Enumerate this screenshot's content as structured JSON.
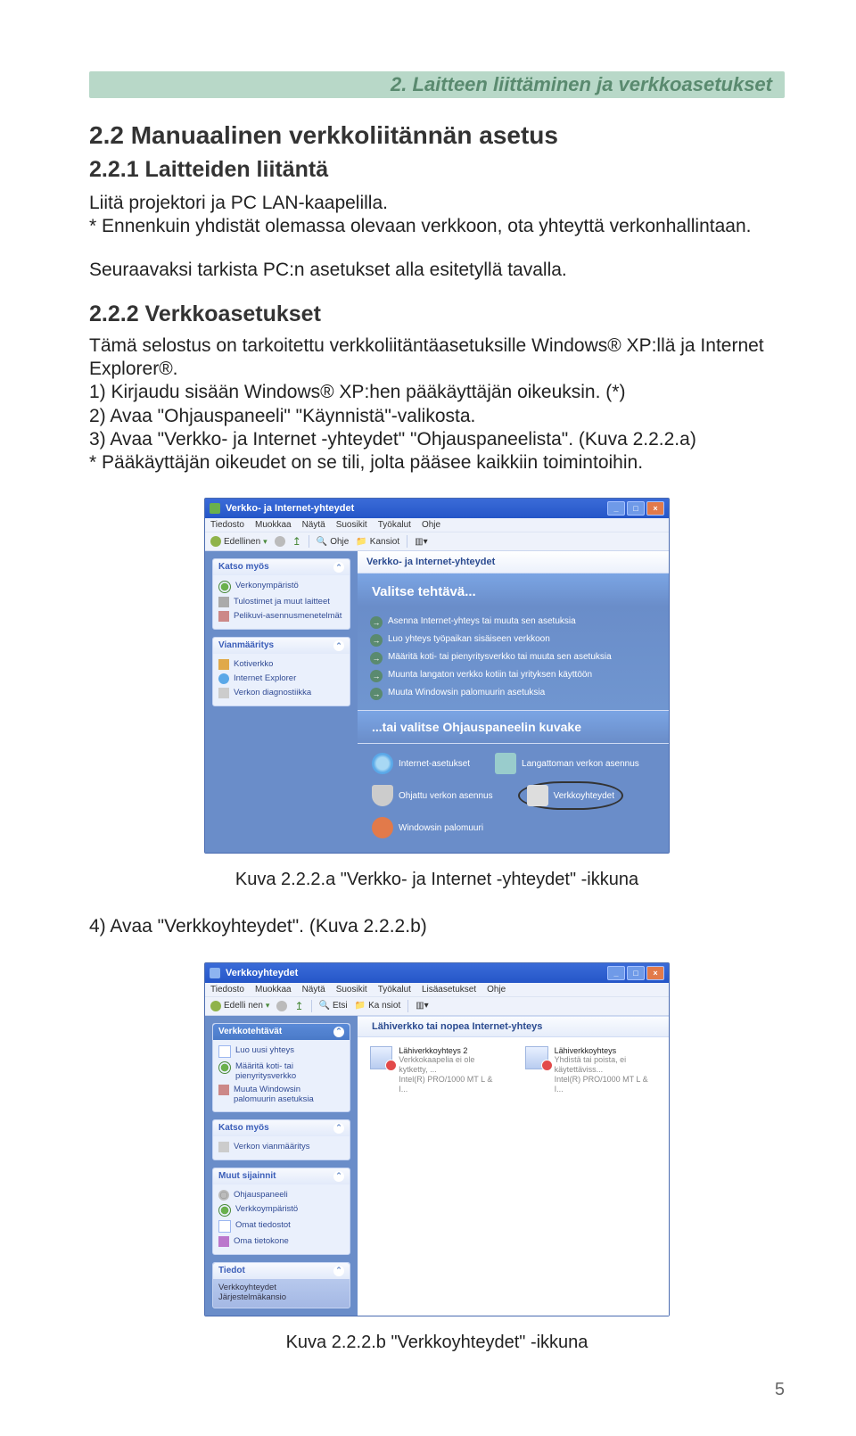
{
  "breadcrumb": "2. Laitteen liittäminen ja verkkoasetukset",
  "heading22": "2.2 Manuaalinen verkkoliitännän asetus",
  "heading221": "2.2.1 Laitteiden liitäntä",
  "p1": "Liitä projektori ja PC LAN-kaapelilla.",
  "p2": "* Ennenkuin yhdistät olemassa olevaan verkkoon, ota yhteyttä verkonhallintaan.",
  "p3": "Seuraavaksi tarkista PC:n asetukset alla esitetyllä tavalla.",
  "heading222": "2.2.2 Verkkoasetukset",
  "intro222": "Tämä selostus on tarkoitettu verkkoliitäntäasetuksille Windows® XP:llä ja Internet Explorer®.",
  "step1": "1) Kirjaudu sisään Windows® XP:hen pääkäyttäjän oikeuksin. (*)",
  "step2": "2) Avaa \"Ohjauspaneeli\" \"Käynnistä\"-valikosta.",
  "step3": "3) Avaa \"Verkko- ja Internet -yhteydet\" \"Ohjauspaneelista\". (Kuva 2.2.2.a)",
  "note": "* Pääkäyttäjän oikeudet on se tili, jolta pääsee kaikkiin toimintoihin.",
  "captionA": "Kuva 2.2.2.a \"Verkko- ja Internet -yhteydet\" -ikkuna",
  "step4": "4) Avaa \"Verkkoyhteydet\". (Kuva 2.2.2.b)",
  "captionB": "Kuva 2.2.2.b \"Verkkoyhteydet\" -ikkuna",
  "pagenum": "5",
  "winA": {
    "title": "Verkko- ja Internet-yhteydet",
    "menu": [
      "Tiedosto",
      "Muokkaa",
      "Näytä",
      "Suosikit",
      "Työkalut",
      "Ohje"
    ],
    "back": "Edellinen",
    "addr": "Ohje",
    "folders": "Kansiot",
    "sb1": {
      "title": "Katso myös",
      "items": [
        "Verkonympäristö",
        "Tulostimet ja muut laitteet",
        "Pelikuvi-asennusmenetelmät"
      ]
    },
    "sb2": {
      "title": "Vianmääritys",
      "items": [
        "Kotiverkko",
        "Internet Explorer",
        "Verkon diagnostiikka"
      ]
    },
    "mhead": "Verkko- ja Internet-yhteydet",
    "mheadblue": "Valitse tehtävä...",
    "tasks": [
      "Asenna Internet-yhteys tai muuta sen asetuksia",
      "Luo yhteys työpaikan sisäiseen verkkoon",
      "Määritä koti- tai pienyritysverkko tai muuta sen asetuksia",
      "Muunta langaton verkko kotiin tai yrityksen käyttöön",
      "Muuta Windowsin palomuurin asetuksia"
    ],
    "ghead": "...tai valitse Ohjauspaneelin kuvake",
    "icons": [
      {
        "label": "Internet-asetukset"
      },
      {
        "label": "Langattoman verkon asennus"
      },
      {
        "label": "Ohjattu verkon asennus"
      },
      {
        "label": "Verkkoyhteydet"
      },
      {
        "label": "Windowsin palomuuri"
      }
    ]
  },
  "winB": {
    "title": "Verkkoyhteydet",
    "menu": [
      "Tiedosto",
      "Muokkaa",
      "Näytä",
      "Suosikit",
      "Työkalut",
      "Lisäasetukset",
      "Ohje"
    ],
    "back": "Edelli nen",
    "addr": "Etsi",
    "folders": "Ka nsiot",
    "mhead": "Lähiverkko tai nopea Internet-yhteys",
    "sb1": {
      "title": "Verkkotehtävät",
      "items": [
        "Luo uusi yhteys",
        "Määritä koti- tai pienyritysverkko",
        "Muuta Windowsin palomuurin asetuksia"
      ]
    },
    "sb2": {
      "title": "Katso myös",
      "items": [
        "Verkon vianmääritys"
      ]
    },
    "sb3": {
      "title": "Muut sijainnit",
      "items": [
        "Ohjauspaneeli",
        "Verkkoympäristö",
        "Omat tiedostot",
        "Oma tietokone"
      ]
    },
    "sb4": {
      "title": "Tiedot",
      "body": "Verkkoyhteydet\nJärjestelmäkansio"
    },
    "conns": [
      {
        "name": "Lähiverkkoyhteys 2",
        "sub1": "Verkkokaapelia ei ole kytketty, ...",
        "sub2": "Intel(R) PRO/1000 MT L & I..."
      },
      {
        "name": "Lähiverkkoyhteys",
        "sub1": "Yhdistä tai poista, ei käytettäviss...",
        "sub2": "Intel(R) PRO/1000 MT L & I..."
      }
    ]
  }
}
